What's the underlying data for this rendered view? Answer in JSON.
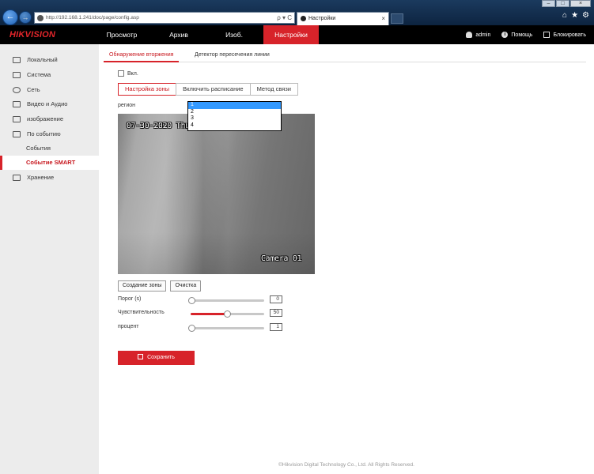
{
  "browser": {
    "address": "http://192.168.1.241/doc/page/config.asp",
    "tab_title": "Настройки",
    "tab_close": "×",
    "address_tools": "ρ ▾ C",
    "window_controls": [
      "–",
      "□",
      "×"
    ]
  },
  "header": {
    "logo": "HIKVISION",
    "menu": [
      "Просмотр",
      "Архив",
      "Изоб.",
      "Настройки"
    ],
    "user": "admin",
    "help": "Помощь",
    "logout": "Блокировать"
  },
  "sidebar": {
    "items": [
      {
        "label": "Локальный",
        "icon": "monitor-icon"
      },
      {
        "label": "Система",
        "icon": "system-icon"
      },
      {
        "label": "Сеть",
        "icon": "network-icon"
      },
      {
        "label": "Видео и Аудио",
        "icon": "video-audio-icon"
      },
      {
        "label": "изображение",
        "icon": "image-icon"
      },
      {
        "label": "По событию",
        "icon": "event-icon"
      },
      {
        "label": "События",
        "icon": ""
      },
      {
        "label": "Событие SMART",
        "icon": ""
      },
      {
        "label": "Хранение",
        "icon": "storage-icon"
      }
    ]
  },
  "subtabs": [
    "Обнаружение вторжения",
    "Детектор пересечения линии"
  ],
  "enable_label": "Вкл.",
  "steps": [
    "Настройка зоны",
    "Включить расписание",
    "Метод связи"
  ],
  "region": {
    "label": "регион",
    "options": [
      "1",
      "2",
      "3",
      "4"
    ],
    "selected": "1"
  },
  "video": {
    "osd_date": "07-30-2020 Thu",
    "osd_camera": "Camera 01"
  },
  "buttons": {
    "create_zone": "Создание зоны",
    "clear": "Очистка",
    "save": "Сохранить"
  },
  "sliders": [
    {
      "label": "Порог (s)",
      "value": "0",
      "fraction": 0.0
    },
    {
      "label": "Чувствительность",
      "value": "50",
      "fraction": 0.5
    },
    {
      "label": "процент",
      "value": "1",
      "fraction": 0.0
    }
  ],
  "colors": {
    "accent": "#d7232a",
    "topbar": "#000000",
    "sidebar": "#ececec"
  },
  "footer": "©Hikvision Digital Technology Co., Ltd. All Rights Reserved."
}
